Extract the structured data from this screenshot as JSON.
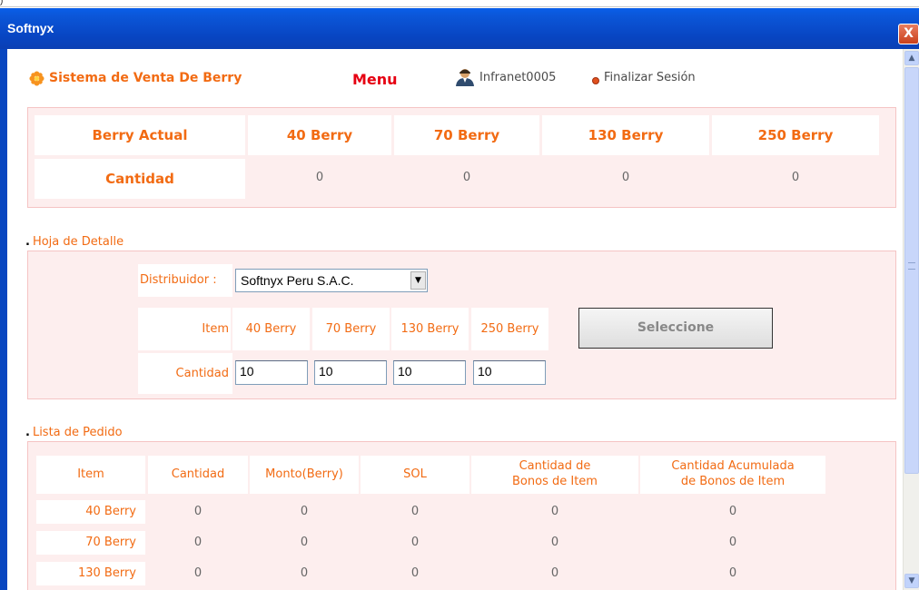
{
  "window": {
    "title": "Softnyx",
    "close_label": "X"
  },
  "header": {
    "brand": "Sistema de Venta De Berry",
    "menu": "Menu",
    "user": "Infranet0005",
    "logout": "Finalizar Sesión"
  },
  "summary": {
    "headers": [
      "Berry Actual",
      "40 Berry",
      "70 Berry",
      "130 Berry",
      "250 Berry"
    ],
    "row_label": "Cantidad",
    "values": [
      "0",
      "0",
      "0",
      "0"
    ]
  },
  "detalle": {
    "section_title": "Hoja de Detalle",
    "distribuidor_label": "Distribuidor :",
    "distribuidor_value": "Softnyx Peru S.A.C.",
    "item_label": "Item",
    "items": [
      "40 Berry",
      "70 Berry",
      "130 Berry",
      "250 Berry"
    ],
    "cantidad_label": "Cantidad",
    "quantities": [
      "10",
      "10",
      "10",
      "10"
    ],
    "select_button": "Seleccione"
  },
  "pedido": {
    "section_title": "Lista de Pedido",
    "columns": [
      "Item",
      "Cantidad",
      "Monto(Berry)",
      "SOL",
      "Cantidad de\nBonos de Item",
      "Cantidad Acumulada\nde Bonos de Item"
    ],
    "rows": [
      {
        "item": "40 Berry",
        "cantidad": "0",
        "monto": "0",
        "sol": "0",
        "bonos": "0",
        "acum": "0"
      },
      {
        "item": "70 Berry",
        "cantidad": "0",
        "monto": "0",
        "sol": "0",
        "bonos": "0",
        "acum": "0"
      },
      {
        "item": "130 Berry",
        "cantidad": "0",
        "monto": "0",
        "sol": "0",
        "bonos": "0",
        "acum": "0"
      }
    ]
  },
  "colors": {
    "accent": "#f26b13",
    "menu": "#e60012",
    "titlebar": "#0a4fd0",
    "panel": "#fdeeee"
  }
}
